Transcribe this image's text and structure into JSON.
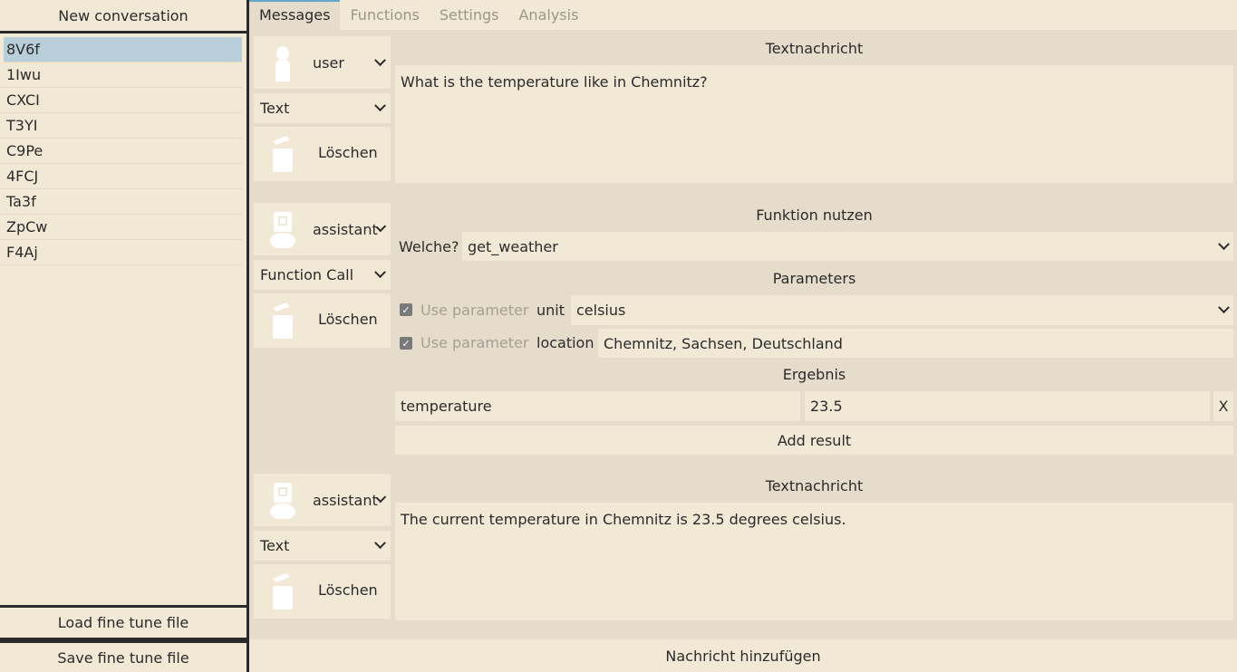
{
  "sidebar": {
    "new_conversation": "New conversation",
    "conversations": [
      "8V6f",
      "1Iwu",
      "CXCI",
      "T3YI",
      "C9Pe",
      "4FCJ",
      "Ta3f",
      "ZpCw",
      "F4Aj"
    ],
    "selected_index": 0,
    "load_label": "Load fine tune file",
    "save_label": "Save fine tune file"
  },
  "tabs": [
    {
      "label": "Messages",
      "active": true
    },
    {
      "label": "Functions",
      "active": false
    },
    {
      "label": "Settings",
      "active": false
    },
    {
      "label": "Analysis",
      "active": false
    }
  ],
  "messages": [
    {
      "role": "user",
      "type": "Text",
      "delete_label": "Löschen",
      "section_title": "Textnachricht",
      "text": "What is the temperature like in Chemnitz?"
    },
    {
      "role": "assistant",
      "type": "Function Call",
      "delete_label": "Löschen",
      "section_title": "Funktion nutzen",
      "which_label": "Welche?",
      "function_name": "get_weather",
      "parameters_title": "Parameters",
      "use_parameter_label": "Use parameter",
      "parameters": [
        {
          "name": "unit",
          "value": "celsius",
          "kind": "dropdown",
          "checked": true
        },
        {
          "name": "location",
          "value": "Chemnitz, Sachsen, Deutschland",
          "kind": "input",
          "checked": true
        }
      ],
      "result_title": "Ergebnis",
      "results": [
        {
          "key": "temperature",
          "value": "23.5",
          "remove_label": "X"
        }
      ],
      "add_result_label": "Add result"
    },
    {
      "role": "assistant",
      "type": "Text",
      "delete_label": "Löschen",
      "section_title": "Textnachricht",
      "text": "The current temperature in Chemnitz is 23.5 degrees celsius."
    }
  ],
  "add_message_label": "Nachricht hinzufügen",
  "colors": {
    "panel_bg": "#f1e8d6",
    "main_bg": "#e6dccb",
    "divider": "#2a2a2a",
    "selected_bg": "#b8cfd9",
    "active_tab_accent": "#62a6cc"
  },
  "icons": {
    "user": "user-silhouette-icon",
    "assistant": "robot-icon",
    "delete": "trash-can-icon",
    "dropdown": "chevron-down-icon",
    "checkbox": "checkmark-icon"
  }
}
